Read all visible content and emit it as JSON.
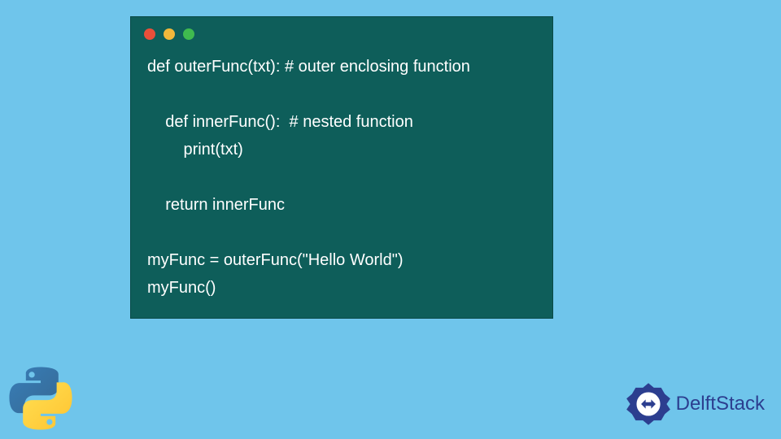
{
  "colors": {
    "page_bg": "#6fc5eb",
    "window_bg": "#0e5e5a",
    "code_fg": "#ffffff",
    "dot_red": "#e94f3a",
    "dot_yellow": "#f2b83b",
    "dot_green": "#3fba4f",
    "brand_color": "#2c3e8f"
  },
  "code": {
    "line1": "def outerFunc(txt): # outer enclosing function",
    "line2": "",
    "line3": "    def innerFunc():  # nested function",
    "line4": "        print(txt)",
    "line5": "",
    "line6": "    return innerFunc",
    "line7": "",
    "line8": "myFunc = outerFunc(\"Hello World\")",
    "line9": "myFunc()"
  },
  "icons": {
    "python": "python-logo",
    "brand_logo": "delftstack-logo"
  },
  "brand": {
    "text": "DelftStack"
  }
}
